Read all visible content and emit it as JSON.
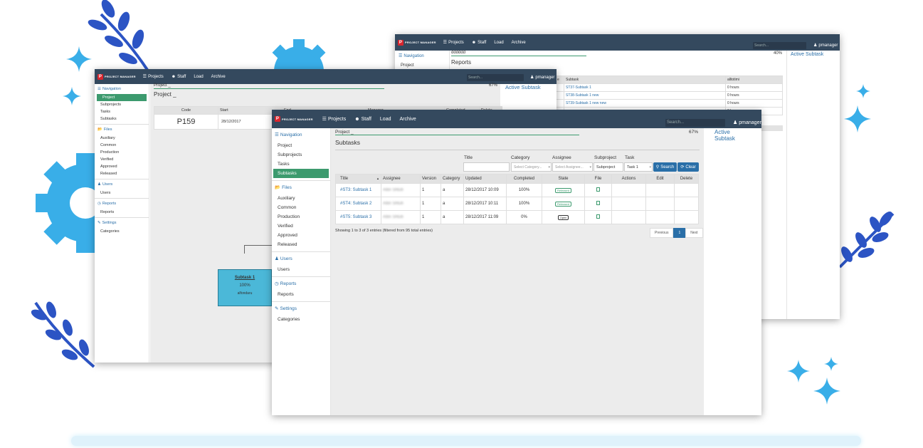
{
  "brand": {
    "logo_text": "PROJECT MANAGER",
    "logo_mark": "P",
    "accent": "#3c9a6e",
    "topbar_color": "#34495e",
    "link_color": "#2a6fa8",
    "deco_color": "#2c54c4"
  },
  "topbar": {
    "menu": [
      {
        "label": "Projects",
        "icon": "list-icon"
      },
      {
        "label": "Staff",
        "icon": "users-icon"
      },
      {
        "label": "Load"
      },
      {
        "label": "Archive"
      }
    ],
    "search_placeholder": "Search...",
    "user": "pmanager"
  },
  "back_window": {
    "breadcrumb": "dddddd",
    "progress": "40%",
    "progress_fraction": 0.4,
    "active_subtask": "Active Subtask",
    "nav_title": "Navigation",
    "nav_first": "Project",
    "page_title": "Reports",
    "columns": [
      "e",
      "Subtask",
      "alltotimi"
    ],
    "rows": [
      {
        "subtask": "ST37-Subtask 1",
        "hours": "0 hours"
      },
      {
        "subtask": "ST38-Subtask 1 new",
        "hours": "0 hours"
      },
      {
        "subtask": "ST39-Subtask 1 new new",
        "hours": "0 hours"
      },
      {
        "subtask": "",
        "hours": "0 hours"
      }
    ]
  },
  "mid_window": {
    "breadcrumb": "Project _",
    "progress": "67%",
    "progress_fraction": 0.67,
    "page_title": "Project _",
    "active_subtask": "Active Subtask",
    "nav": {
      "title": "Navigation",
      "items": [
        "Project",
        "Subprojects",
        "Tasks",
        "Subtasks"
      ],
      "files_title": "Files",
      "files": [
        "Auxiliary",
        "Common",
        "Production",
        "Verified",
        "Approved",
        "Released"
      ],
      "users_title": "Users",
      "users": [
        "Users"
      ],
      "reports_title": "Reports",
      "reports": [
        "Reports"
      ],
      "settings_title": "Settings",
      "settings": [
        "Categories"
      ]
    },
    "table": {
      "columns": [
        "Code",
        "Start",
        "End",
        "Manager",
        "Completed",
        "Delete"
      ],
      "code": "P159",
      "start": "28/12/2017"
    },
    "node": {
      "title": "Subtask 1",
      "percent": "100%",
      "sub": "alfondaru"
    }
  },
  "front_window": {
    "breadcrumb": "Project _",
    "progress": "67%",
    "progress_fraction": 0.67,
    "page_title": "Subtasks",
    "active_subtask": "Active Subtask",
    "nav": {
      "title": "Navigation",
      "items": [
        "Project",
        "Subprojects",
        "Tasks",
        "Subtasks"
      ],
      "files_title": "Files",
      "files": [
        "Auxiliary",
        "Common",
        "Production",
        "Verified",
        "Approved",
        "Released"
      ],
      "users_title": "Users",
      "users": [
        "Users"
      ],
      "reports_title": "Reports",
      "reports": [
        "Reports"
      ],
      "settings_title": "Settings",
      "settings": [
        "Categories"
      ]
    },
    "filters": {
      "title_label": "Title",
      "category_label": "Category",
      "category_placeholder": "Select Category...",
      "assignee_label": "Assignee",
      "assignee_placeholder": "Select Assignee...",
      "subproject_label": "Subproject",
      "subproject_value": "Subproject",
      "task_label": "Task",
      "task_value": "Task 1",
      "search_button": "Search",
      "clear_button": "Clear"
    },
    "columns": [
      "Title",
      "Assignee",
      "Version",
      "Category",
      "Updated",
      "Completed",
      "State",
      "File",
      "Actions",
      "Edit",
      "Delete"
    ],
    "rows": [
      {
        "title": "#ST3: Subtask 1",
        "assignee": "Altin Shtufi",
        "version": "1",
        "category": "a",
        "updated": "28/12/2017 10:09",
        "completed": "100%",
        "state": "Released"
      },
      {
        "title": "#ST4: Subtask 2",
        "assignee": "Altin Shtufi",
        "version": "1",
        "category": "a",
        "updated": "28/12/2017 10:11",
        "completed": "100%",
        "state": "Released"
      },
      {
        "title": "#ST5: Subtask 3",
        "assignee": "Altin Shtufi",
        "version": "1",
        "category": "a",
        "updated": "28/12/2017 11:09",
        "completed": "0%",
        "state": "Open"
      }
    ],
    "showing": "Showing 1 to 3 of 3 entries (filtered from 95 total entries)",
    "pagination": {
      "previous": "Previous",
      "current": "1",
      "next": "Next"
    }
  }
}
